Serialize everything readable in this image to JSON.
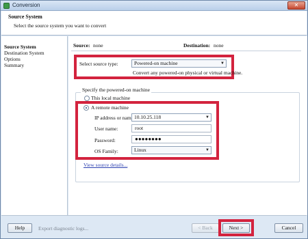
{
  "window": {
    "title": "Conversion",
    "close_glyph": "✕"
  },
  "header": {
    "title": "Source System",
    "subtitle": "Select the source system you want to convert"
  },
  "sidebar": {
    "items": [
      {
        "label": "Source System",
        "active": true
      },
      {
        "label": "Destination System",
        "active": false
      },
      {
        "label": "Options",
        "active": false
      },
      {
        "label": "Summary",
        "active": false
      }
    ]
  },
  "summary_bar": {
    "source_label": "Source:",
    "source_value": "none",
    "destination_label": "Destination:",
    "destination_value": "none"
  },
  "source_type": {
    "label": "Select source type:",
    "selected": "Powered-on machine",
    "description": "Convert any powered-on physical or virtual machine."
  },
  "machine": {
    "group_label": "Specify the powered-on machine",
    "option_local": "This local machine",
    "option_remote": "A remote machine",
    "selected_option": "A remote machine",
    "ip_label": "IP address or name:",
    "ip_value": "10.10.25.118",
    "user_label": "User name:",
    "user_value": "root",
    "password_label": "Password:",
    "password_mask": "●●●●●●●●",
    "os_label": "OS Family:",
    "os_value": "Linux"
  },
  "view_source_details": "View source details...",
  "footer": {
    "help": "Help",
    "export_logs": "Export diagnostic logs...",
    "back": "< Back",
    "next": "Next >",
    "cancel": "Cancel"
  },
  "colors": {
    "highlight": "#d3233e",
    "window_bg": "#dde8f4",
    "link": "#2a3fb0"
  },
  "icons": {
    "app": "converter-app-icon",
    "close": "close-icon",
    "dropdown": "chevron-down-icon"
  }
}
